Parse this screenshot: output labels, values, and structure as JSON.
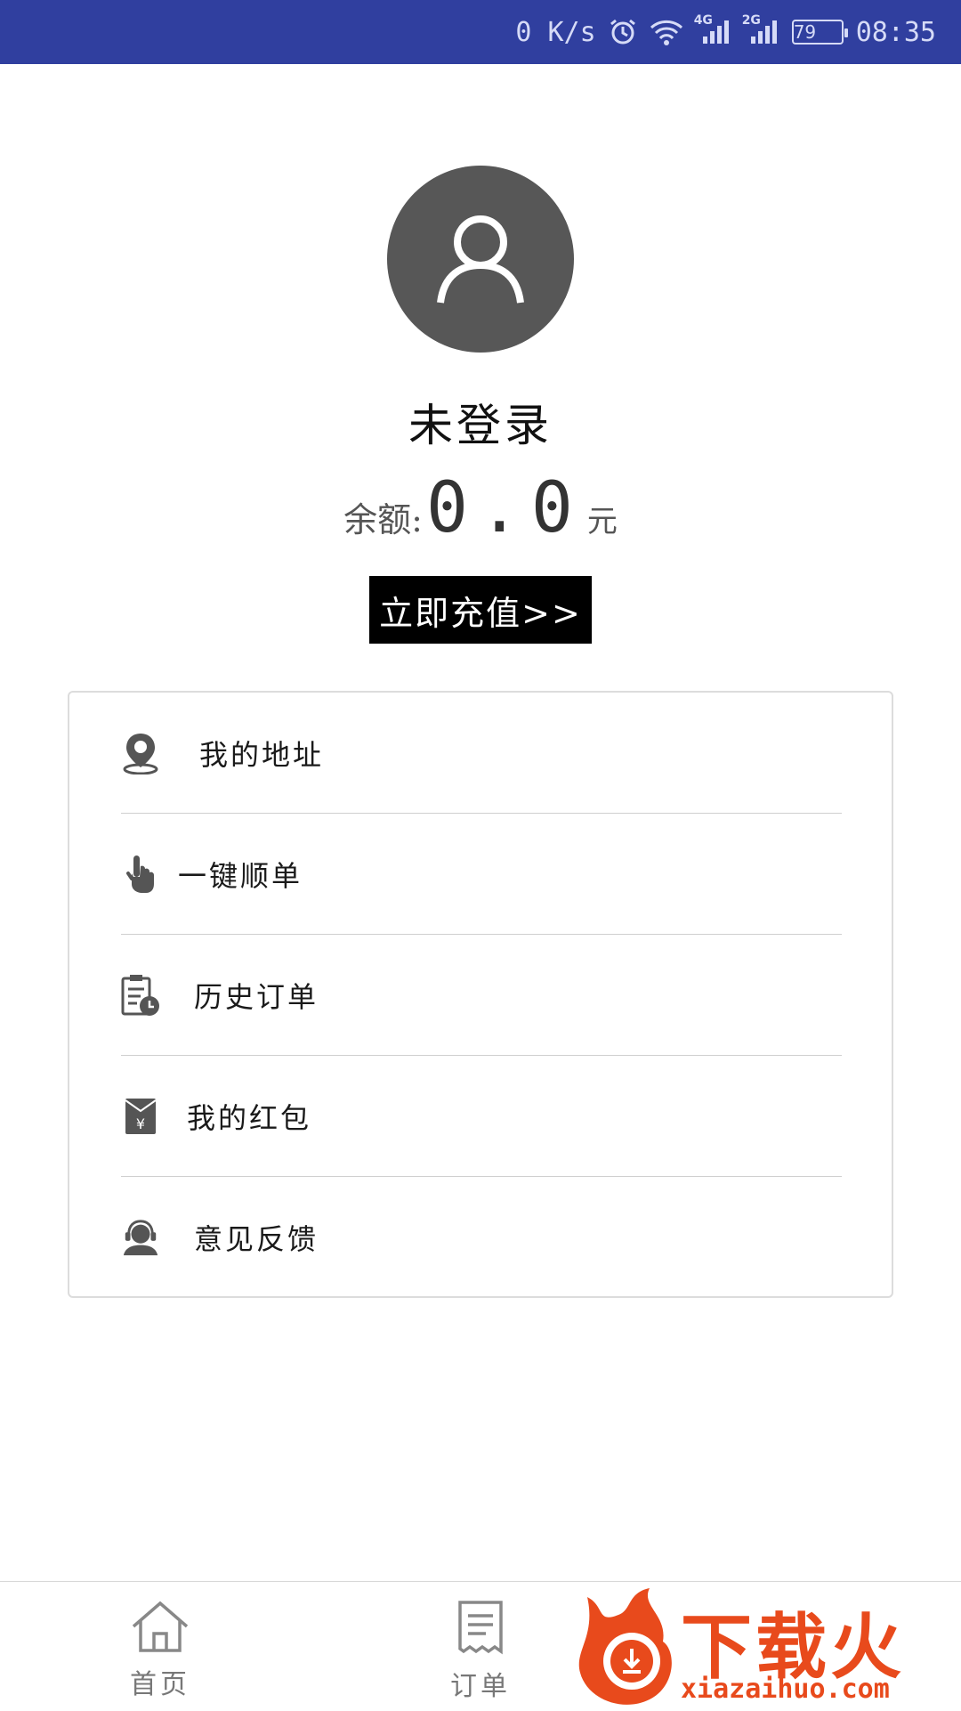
{
  "status_bar": {
    "net_speed": "0 K/s",
    "sim1_type": "4G",
    "sim2_type": "2G",
    "battery": "79",
    "time": "08:35"
  },
  "profile": {
    "avatar_icon": "user-icon",
    "username": "未登录",
    "balance_label": "余额:",
    "balance_value": "0.0",
    "balance_unit": "元",
    "recharge_label": "立即充值>>"
  },
  "menu": {
    "items": [
      {
        "icon": "location-pin-icon",
        "label": "我的地址"
      },
      {
        "icon": "hand-tap-icon",
        "label": "一键顺单"
      },
      {
        "icon": "clipboard-clock-icon",
        "label": "历史订单"
      },
      {
        "icon": "red-envelope-icon",
        "label": "我的红包"
      },
      {
        "icon": "customer-service-icon",
        "label": "意见反馈"
      }
    ]
  },
  "bottom_nav": {
    "tabs": [
      {
        "icon": "home-icon",
        "label": "首页"
      },
      {
        "icon": "receipt-icon",
        "label": "订单"
      }
    ]
  },
  "watermark": {
    "text_cn": "下载火",
    "text_en": "xiazaihuo.com"
  },
  "colors": {
    "status_bar": "#303f9f",
    "avatar_bg": "#575757",
    "recharge_bg": "#000000",
    "watermark": "#e84a1c"
  }
}
